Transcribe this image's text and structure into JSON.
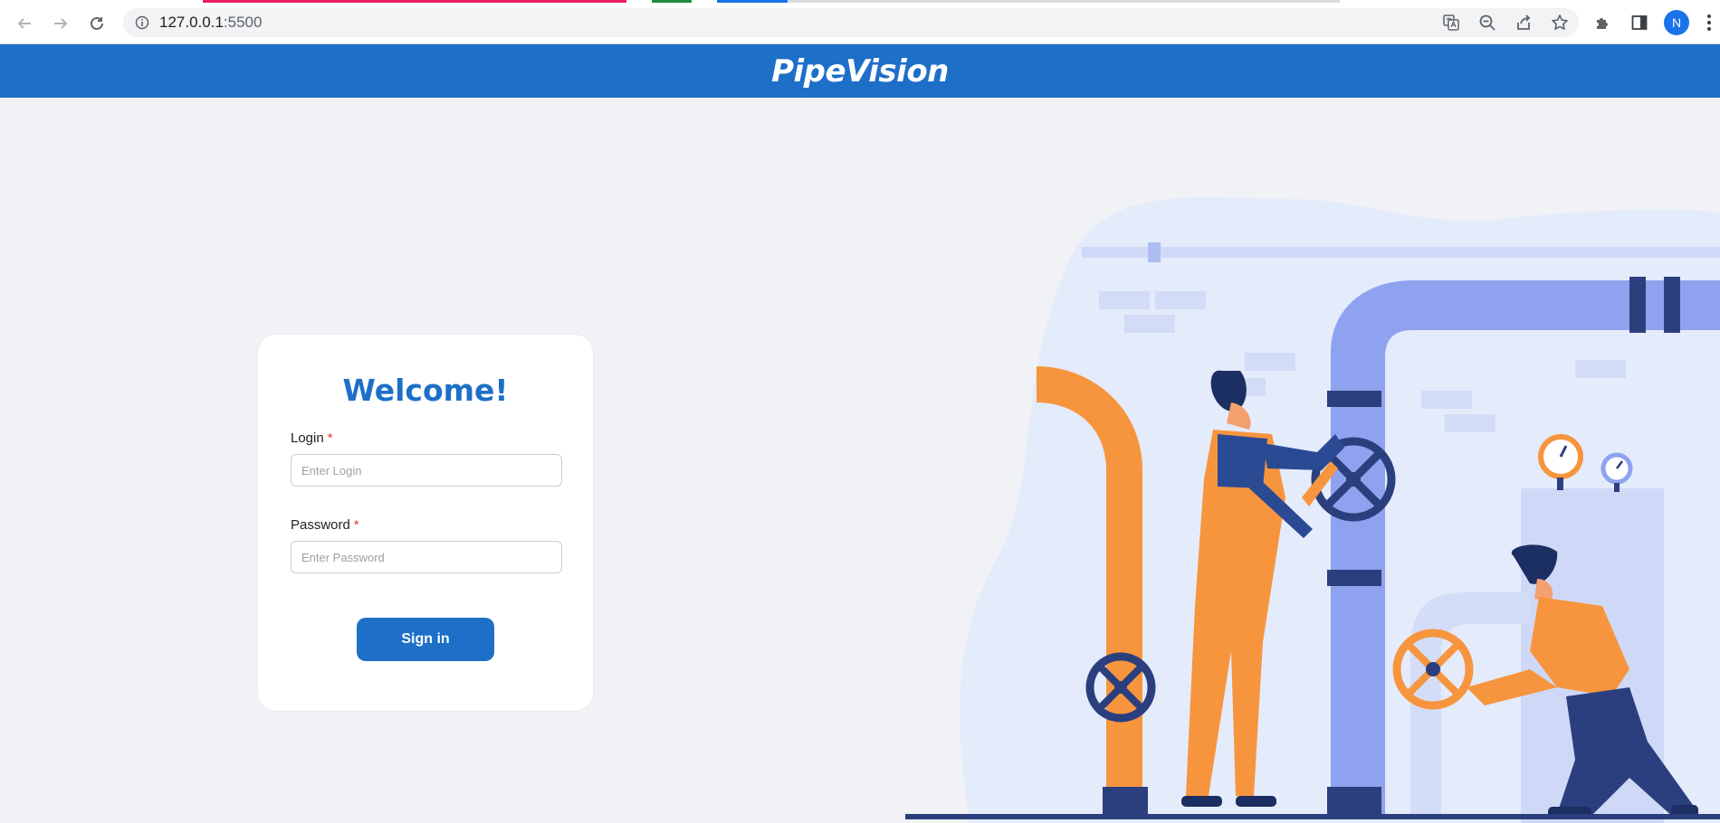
{
  "browser": {
    "url_host": "127.0.0.1",
    "url_port": ":5500",
    "profile_initial": "N",
    "tab_colors": [
      "#e91e63",
      "#1e8e3e",
      "#1a73e8"
    ]
  },
  "header": {
    "brand": "PipeVision",
    "color": "#1d6fc8"
  },
  "login_card": {
    "title": "Welcome!",
    "login_label": "Login",
    "login_placeholder": "Enter Login",
    "login_value": "",
    "password_label": "Password",
    "password_placeholder": "Enter Password",
    "password_value": "",
    "required_mark": "*",
    "submit_label": "Sign in"
  },
  "illustration": {
    "subject": "plumbers-working-on-pipes",
    "colors": {
      "blob": "#e4ebfb",
      "pipe_blue": "#8fa2f0",
      "pipe_orange": "#f7953e",
      "navy": "#2b3f7e"
    }
  }
}
